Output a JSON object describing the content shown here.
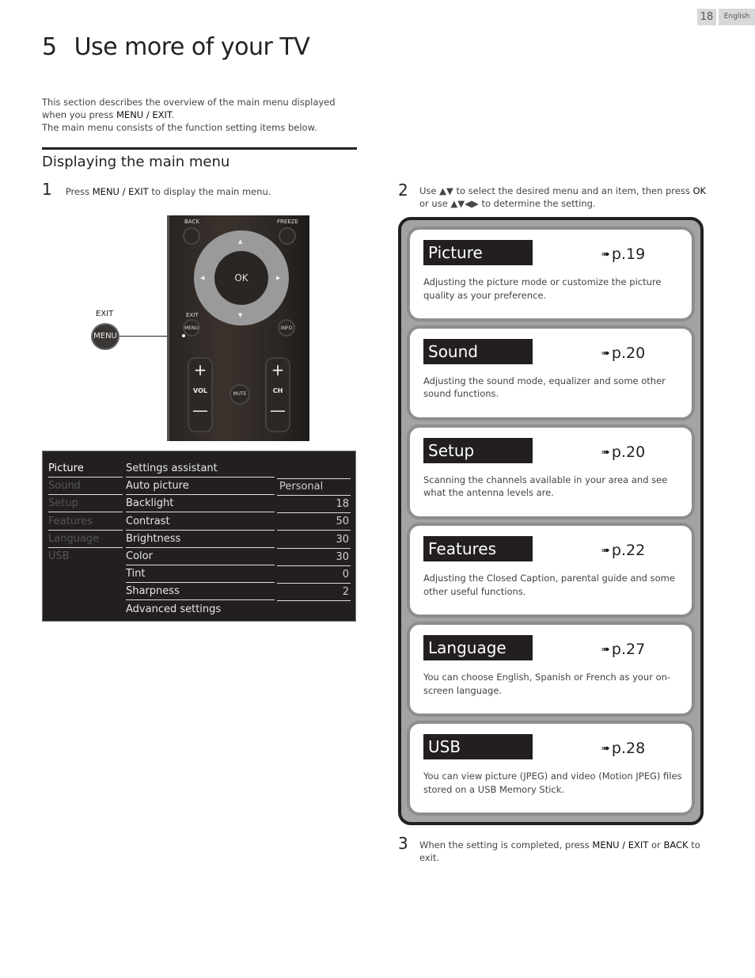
{
  "page": {
    "number": "18",
    "language": "English"
  },
  "header": {
    "chapter_number": "5",
    "title": "Use more of your TV"
  },
  "intro": {
    "line1_pre": "This section describes the overview of the main menu displayed when you press ",
    "line1_key": "MENU / EXIT",
    "line1_post": ".",
    "line2": "The main menu consists of the function setting items below."
  },
  "section": {
    "title": "Displaying the main menu"
  },
  "steps": [
    {
      "number": "1",
      "pre": "Press ",
      "key": "MENU / EXIT",
      "post": " to display the main menu."
    },
    {
      "number": "2",
      "pre": "Use ▲▼ to select the desired menu and an item, then press ",
      "key": "OK",
      "post": " or use ▲▼◀▶ to determine the setting."
    },
    {
      "number": "3",
      "pre": "When the setting is completed, press ",
      "key": "MENU / EXIT",
      "mid": " or ",
      "key2": "BACK",
      "post": " to exit."
    }
  ],
  "remote": {
    "back": "BACK",
    "freeze": "FREEZE",
    "ok": "OK",
    "exit": "EXIT",
    "menu": "MENU",
    "info": "INFO",
    "vol": "VOL",
    "ch": "CH",
    "mute": "MUTE",
    "plus": "+",
    "minus": "—",
    "arrow_up": "▲",
    "arrow_down": "▼",
    "arrow_left": "◀",
    "arrow_right": "▶",
    "callout_exit": "EXIT",
    "callout_menu": "MENU"
  },
  "tv_menu": {
    "categories": [
      {
        "label": "Picture",
        "active": true
      },
      {
        "label": "Sound",
        "active": false
      },
      {
        "label": "Setup",
        "active": false
      },
      {
        "label": "Features",
        "active": false
      },
      {
        "label": "Language",
        "active": false
      },
      {
        "label": "USB",
        "active": false
      }
    ],
    "items": [
      {
        "label": "Settings assistant",
        "value": ""
      },
      {
        "label": "Auto picture",
        "value": "Personal"
      },
      {
        "label": "Backlight",
        "value": "18"
      },
      {
        "label": "Contrast",
        "value": "50"
      },
      {
        "label": "Brightness",
        "value": "30"
      },
      {
        "label": "Color",
        "value": "30"
      },
      {
        "label": "Tint",
        "value": "0"
      },
      {
        "label": "Sharpness",
        "value": "2"
      },
      {
        "label": "Advanced settings",
        "value": ""
      }
    ]
  },
  "menu_cards": [
    {
      "title": "Picture",
      "ref": "p.19",
      "desc": "Adjusting the picture mode or customize the picture quality as your preference."
    },
    {
      "title": "Sound",
      "ref": "p.20",
      "desc": "Adjusting the sound mode, equalizer and some other sound functions."
    },
    {
      "title": "Setup",
      "ref": "p.20",
      "desc": "Scanning the channels available in your area and see what the antenna levels are."
    },
    {
      "title": "Features",
      "ref": "p.22",
      "desc": "Adjusting the Closed Caption, parental guide and some other useful functions."
    },
    {
      "title": "Language",
      "ref": "p.27",
      "desc": "You can choose English, Spanish or French as your on-screen language."
    },
    {
      "title": "USB",
      "ref": "p.28",
      "desc": "You can view picture (JPEG) and video (Motion JPEG) files stored on a USB Memory Stick."
    }
  ],
  "icons": {
    "ref_arrow": "➠"
  }
}
